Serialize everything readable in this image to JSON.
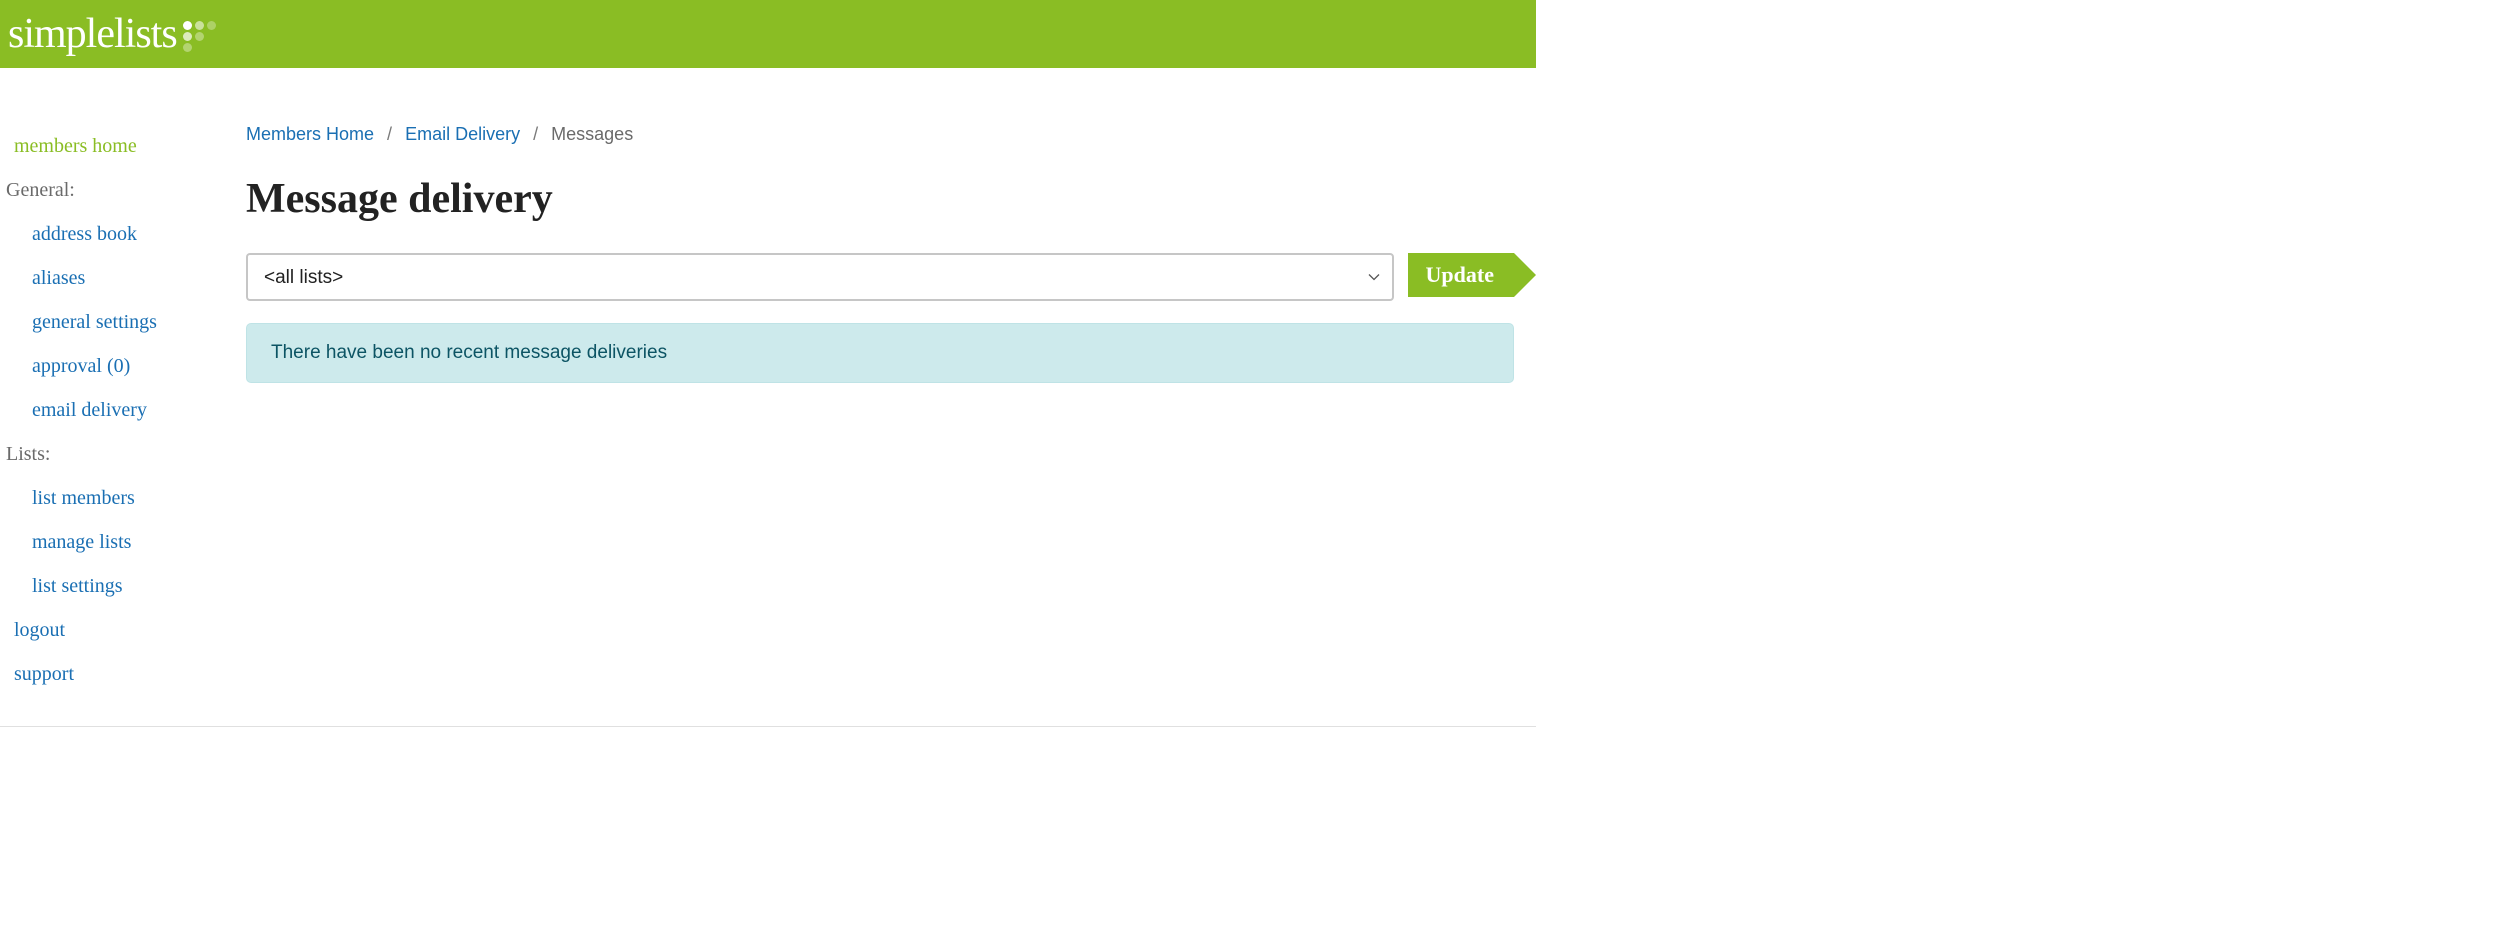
{
  "brand": {
    "name": "simplelists"
  },
  "sidebar": {
    "home": "members home",
    "section_general": "General:",
    "items_general": [
      "address book",
      "aliases",
      "general settings",
      "approval (0)",
      "email delivery"
    ],
    "section_lists": "Lists:",
    "items_lists": [
      "list members",
      "manage lists",
      "list settings"
    ],
    "logout": "logout",
    "support": "support"
  },
  "breadcrumb": {
    "home": "Members Home",
    "delivery": "Email Delivery",
    "current": "Messages"
  },
  "page": {
    "title": "Message delivery",
    "select_value": "<all lists>",
    "update_label": "Update",
    "info_message": "There have been no recent message deliveries"
  }
}
